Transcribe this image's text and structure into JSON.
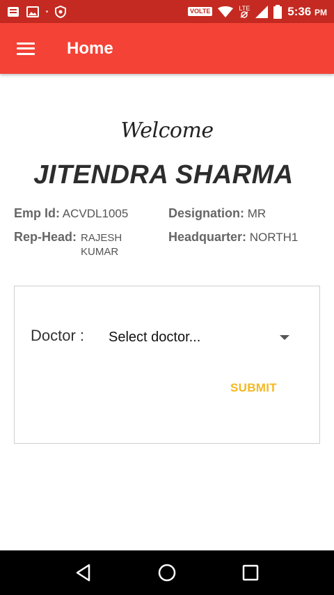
{
  "status_bar": {
    "volte": "VOLTE",
    "lte": "LTE",
    "time": "5:36",
    "ampm": "PM",
    "icons": [
      "notes-icon",
      "image-icon",
      "shield-icon",
      "wifi-icon",
      "signal-icon",
      "battery-icon"
    ]
  },
  "app_bar": {
    "title": "Home",
    "menu_icon": "hamburger-menu-icon"
  },
  "profile": {
    "welcome": "Welcome",
    "name": "JITENDRA SHARMA",
    "emp_id_label": "Emp Id:",
    "emp_id_value": "ACVDL1005",
    "designation_label": "Designation:",
    "designation_value": "MR",
    "rep_head_label": "Rep-Head:",
    "rep_head_value": "RAJESH KUMAR",
    "headquarter_label": "Headquarter:",
    "headquarter_value": "NORTH1"
  },
  "form": {
    "doctor_label": "Doctor :",
    "doctor_selected": "Select doctor...",
    "submit_label": "SUBMIT"
  },
  "colors": {
    "status_bar": "#c42a21",
    "app_bar": "#f44236",
    "submit": "#f5b81f"
  },
  "nav_bar": {
    "icons": [
      "back-icon",
      "home-icon",
      "recents-icon"
    ]
  }
}
